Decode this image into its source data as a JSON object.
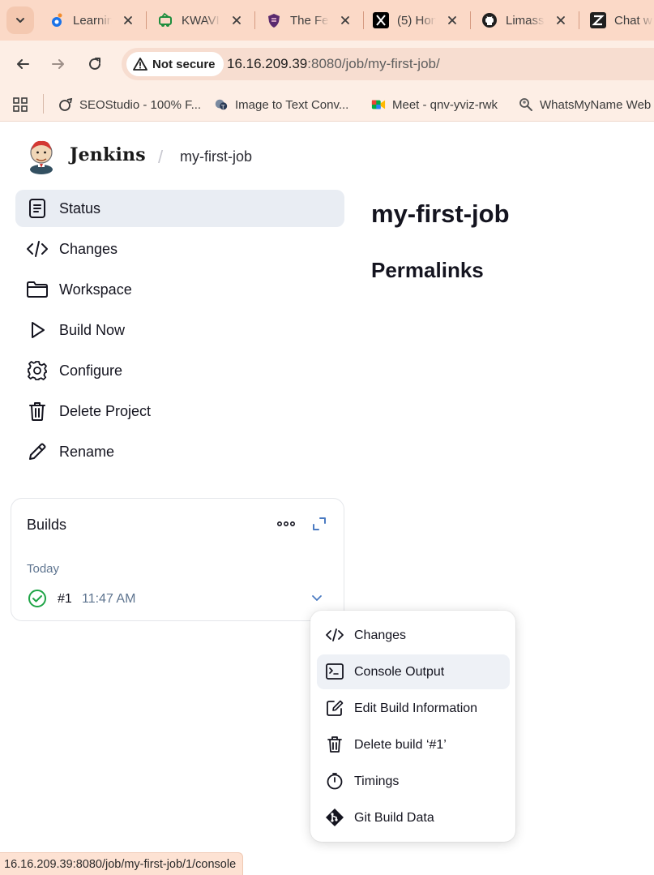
{
  "browser": {
    "tabs": [
      {
        "title": "Learnin",
        "icon": "learning-favicon"
      },
      {
        "title": "KWAVI",
        "icon": "kwavi-favicon"
      },
      {
        "title": "The Fe",
        "icon": "shield-favicon"
      },
      {
        "title": "(5) Hon",
        "icon": "x-favicon"
      },
      {
        "title": "Limass",
        "icon": "github-favicon"
      },
      {
        "title": "Chat w",
        "icon": "z-favicon"
      }
    ],
    "security_label": "Not secure",
    "url_host": "16.16.209.39",
    "url_rest": ":8080/job/my-first-job/",
    "bookmarks": [
      {
        "label": "SEOStudio - 100% F...",
        "icon": "seostudio-icon"
      },
      {
        "label": "Image to Text Conv...",
        "icon": "image-to-text-icon"
      },
      {
        "label": "Meet - qnv-yviz-rwk",
        "icon": "meet-icon"
      },
      {
        "label": "WhatsMyName Web",
        "icon": "whatsmyname-icon"
      }
    ],
    "status_url": "16.16.209.39:8080/job/my-first-job/1/console"
  },
  "header": {
    "brand": "Jenkins",
    "separator": "/",
    "breadcrumb": "my-first-job"
  },
  "sidebar": {
    "items": [
      {
        "label": "Status",
        "icon": "status-icon",
        "active": true
      },
      {
        "label": "Changes",
        "icon": "code-icon"
      },
      {
        "label": "Workspace",
        "icon": "folder-icon"
      },
      {
        "label": "Build Now",
        "icon": "play-icon"
      },
      {
        "label": "Configure",
        "icon": "gear-icon"
      },
      {
        "label": "Delete Project",
        "icon": "trash-icon"
      },
      {
        "label": "Rename",
        "icon": "pencil-icon"
      }
    ]
  },
  "main": {
    "job_title": "my-first-job",
    "permalinks_heading": "Permalinks"
  },
  "builds": {
    "title": "Builds",
    "day_label": "Today",
    "rows": [
      {
        "number": "#1",
        "time": "11:47 AM",
        "status": "success"
      }
    ]
  },
  "build_menu": {
    "items": [
      {
        "label": "Changes",
        "icon": "code-icon"
      },
      {
        "label": "Console Output",
        "icon": "terminal-icon",
        "hover": true
      },
      {
        "label": "Edit Build Information",
        "icon": "edit-icon"
      },
      {
        "label": "Delete build ‘#1’",
        "icon": "trash-icon"
      },
      {
        "label": "Timings",
        "icon": "stopwatch-icon"
      },
      {
        "label": "Git Build Data",
        "icon": "git-icon"
      }
    ]
  },
  "colors": {
    "tabstrip": "#fbd9c7",
    "toolbar": "#fdeee5",
    "active_item": "#e9edf3",
    "success": "#1ea446",
    "muted_text": "#5f7590",
    "accent_blue": "#4b7bc2"
  }
}
